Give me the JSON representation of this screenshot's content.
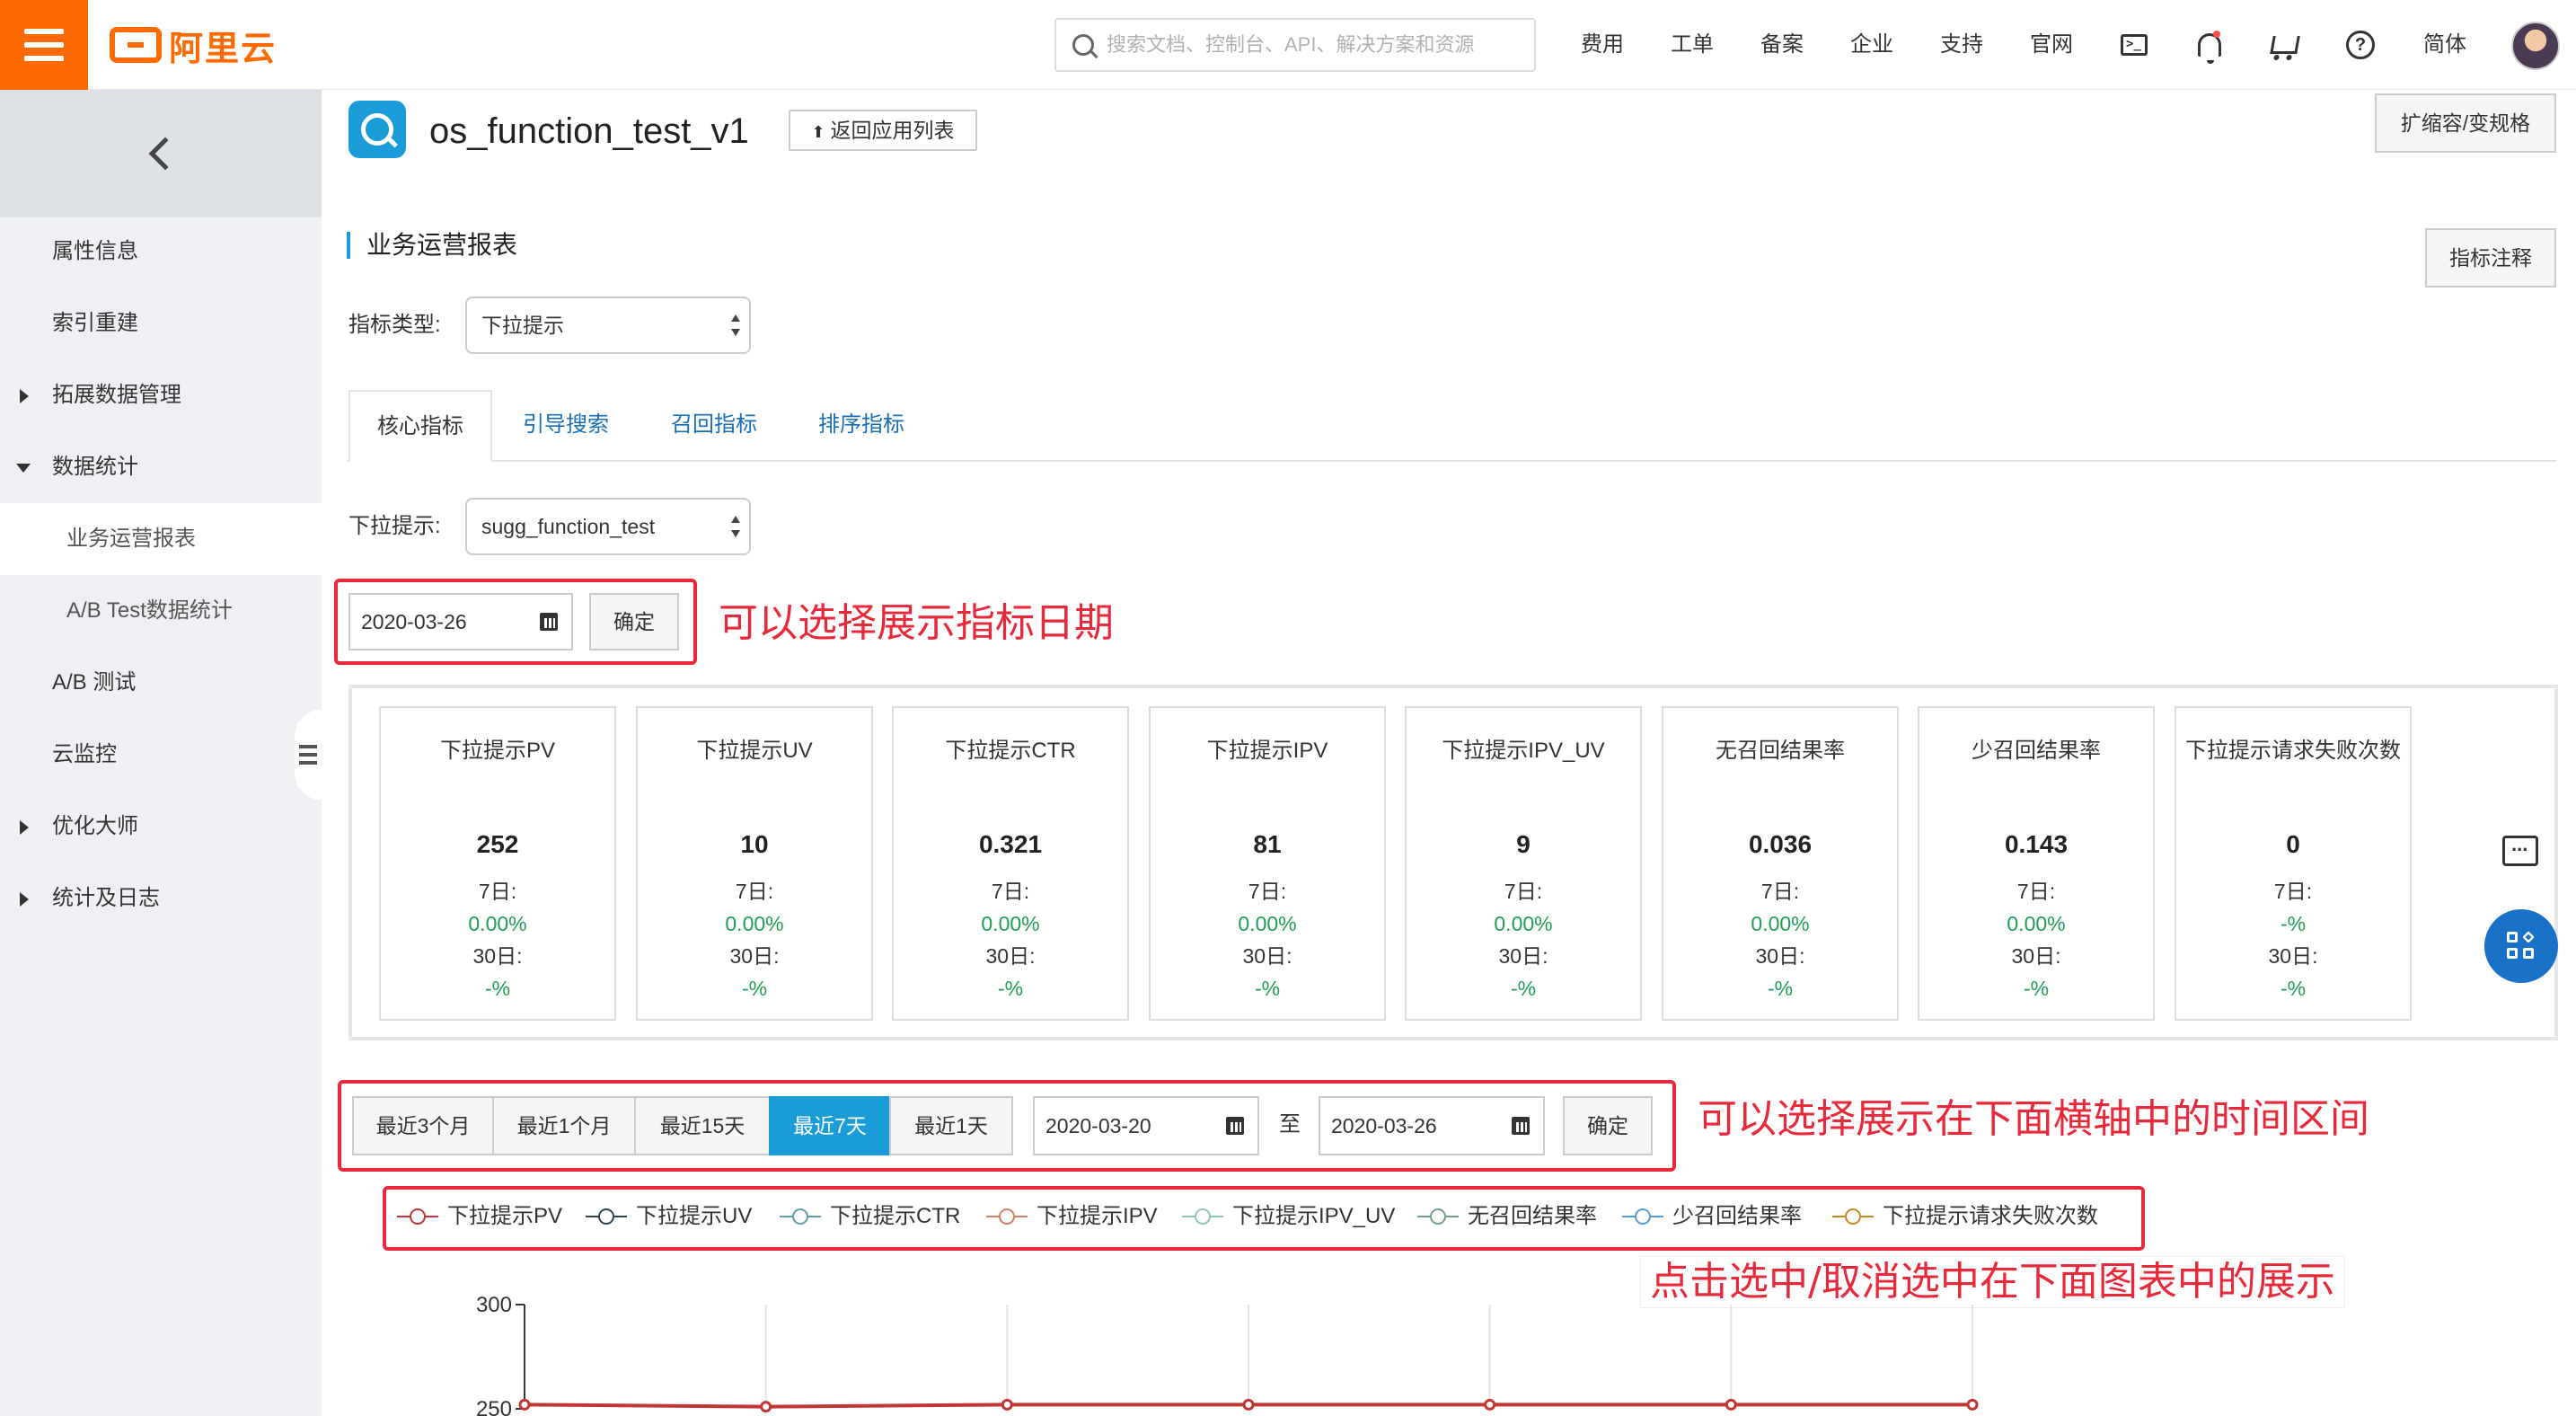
{
  "topbar": {
    "brand": "阿里云",
    "search_placeholder": "搜索文档、控制台、API、解决方案和资源",
    "nav": [
      "费用",
      "工单",
      "备案",
      "企业",
      "支持",
      "官网"
    ],
    "language": "简体",
    "icons": [
      "terminal-icon",
      "bell-icon",
      "cart-icon",
      "help-icon"
    ],
    "brand_color": "#ff6a00"
  },
  "sidebar": {
    "items": [
      {
        "label": "属性信息"
      },
      {
        "label": "索引重建"
      },
      {
        "label": "拓展数据管理",
        "arrow": "right"
      },
      {
        "label": "数据统计",
        "arrow": "down"
      },
      {
        "label": "业务运营报表",
        "sub": true,
        "active": true
      },
      {
        "label": "A/B Test数据统计",
        "sub": true
      },
      {
        "label": "A/B 测试"
      },
      {
        "label": "云监控"
      },
      {
        "label": "优化大师",
        "arrow": "right"
      },
      {
        "label": "统计及日志",
        "arrow": "right"
      }
    ]
  },
  "header": {
    "app_name": "os_function_test_v1",
    "back_label": "返回应用列表",
    "scale_label": "扩缩容/变规格"
  },
  "report": {
    "title": "业务运营报表",
    "note_label": "指标注释",
    "metric_type_label": "指标类型:",
    "metric_type_value": "下拉提示",
    "tabs": [
      "核心指标",
      "引导搜索",
      "召回指标",
      "排序指标"
    ],
    "sugg_label": "下拉提示:",
    "sugg_value": "sugg_function_test",
    "date_value": "2020-03-26",
    "confirm_label": "确定"
  },
  "annotations": {
    "date_note": "可以选择展示指标日期",
    "range_note": "可以选择展示在下面横轴中的时间区间",
    "legend_note": "点击选中/取消选中在下面图表中的展示",
    "color": "#e8293a"
  },
  "cards": [
    {
      "title": "下拉提示PV",
      "value": "252",
      "l7": "7日:",
      "v7": "0.00%",
      "l30": "30日:",
      "v30": "-%"
    },
    {
      "title": "下拉提示UV",
      "value": "10",
      "l7": "7日:",
      "v7": "0.00%",
      "l30": "30日:",
      "v30": "-%"
    },
    {
      "title": "下拉提示CTR",
      "value": "0.321",
      "l7": "7日:",
      "v7": "0.00%",
      "l30": "30日:",
      "v30": "-%"
    },
    {
      "title": "下拉提示IPV",
      "value": "81",
      "l7": "7日:",
      "v7": "0.00%",
      "l30": "30日:",
      "v30": "-%"
    },
    {
      "title": "下拉提示IPV_UV",
      "value": "9",
      "l7": "7日:",
      "v7": "0.00%",
      "l30": "30日:",
      "v30": "-%"
    },
    {
      "title": "无召回结果率",
      "value": "0.036",
      "l7": "7日:",
      "v7": "0.00%",
      "l30": "30日:",
      "v30": "-%"
    },
    {
      "title": "少召回结果率",
      "value": "0.143",
      "l7": "7日:",
      "v7": "0.00%",
      "l30": "30日:",
      "v30": "-%"
    },
    {
      "title": "下拉提示请求失败次数",
      "value": "0",
      "l7": "7日:",
      "v7": "-%",
      "l30": "30日:",
      "v30": "-%"
    }
  ],
  "range": {
    "buttons": [
      "最近3个月",
      "最近1个月",
      "最近15天",
      "最近7天",
      "最近1天"
    ],
    "active_index": 3,
    "start": "2020-03-20",
    "to_label": "至",
    "end": "2020-03-26",
    "confirm_label": "确定"
  },
  "legend": [
    {
      "name": "下拉提示PV",
      "color": "#c23531"
    },
    {
      "name": "下拉提示UV",
      "color": "#2f4554"
    },
    {
      "name": "下拉提示CTR",
      "color": "#61a0a8"
    },
    {
      "name": "下拉提示IPV",
      "color": "#d48265"
    },
    {
      "name": "下拉提示IPV_UV",
      "color": "#91c7ae"
    },
    {
      "name": "无召回结果率",
      "color": "#749f83"
    },
    {
      "name": "少召回结果率",
      "color": "#5b9bd5"
    },
    {
      "name": "下拉提示请求失败次数",
      "color": "#ca8622"
    }
  ],
  "chart_data": {
    "type": "line",
    "y_ticks": [
      "300",
      "250"
    ],
    "ylim": [
      250,
      300
    ],
    "series": [
      {
        "name": "下拉提示PV",
        "color": "#c23531",
        "values": [
          252,
          251,
          252,
          252,
          252,
          252,
          252
        ]
      }
    ]
  }
}
